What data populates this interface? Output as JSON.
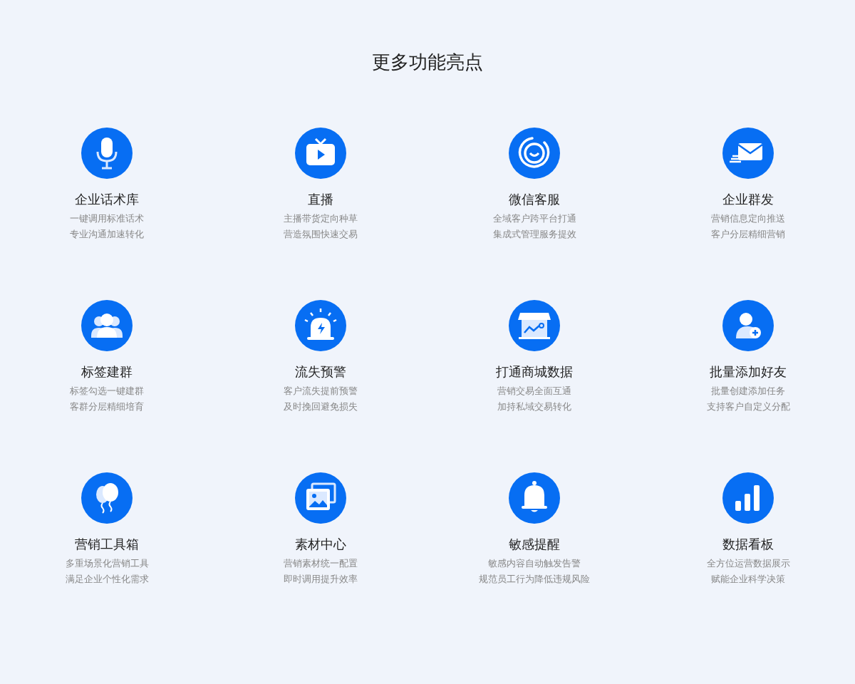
{
  "title": "更多功能亮点",
  "features": [
    {
      "kind": "microphone",
      "name": "企业话术库",
      "lines": [
        "一键调用标准话术",
        "专业沟通加速转化"
      ]
    },
    {
      "kind": "tv",
      "name": "直播",
      "lines": [
        "主播带货定向种草",
        "营造氛围快速交易"
      ]
    },
    {
      "kind": "smile",
      "name": "微信客服",
      "lines": [
        "全域客户跨平台打通",
        "集成式管理服务提效"
      ]
    },
    {
      "kind": "mail",
      "name": "企业群发",
      "lines": [
        "营销信息定向推送",
        "客户分层精细营销"
      ]
    },
    {
      "kind": "group",
      "name": "标签建群",
      "lines": [
        "标签勾选一键建群",
        "客群分层精细培育"
      ]
    },
    {
      "kind": "alarm",
      "name": "流失预警",
      "lines": [
        "客户流失提前预警",
        "及时挽回避免损失"
      ]
    },
    {
      "kind": "store",
      "name": "打通商城数据",
      "lines": [
        "营销交易全面互通",
        "加持私域交易转化"
      ]
    },
    {
      "kind": "adduser",
      "name": "批量添加好友",
      "lines": [
        "批量创建添加任务",
        "支持客户自定义分配"
      ]
    },
    {
      "kind": "balloon",
      "name": "营销工具箱",
      "lines": [
        "多重场景化营销工具",
        "满足企业个性化需求"
      ]
    },
    {
      "kind": "image",
      "name": "素材中心",
      "lines": [
        "营销素材统一配置",
        "即时调用提升效率"
      ]
    },
    {
      "kind": "bell",
      "name": "敏感提醒",
      "lines": [
        "敏感内容自动触发告警",
        "规范员工行为降低违规风险"
      ]
    },
    {
      "kind": "bars",
      "name": "数据看板",
      "lines": [
        "全方位运营数据展示",
        "赋能企业科学决策"
      ]
    }
  ]
}
